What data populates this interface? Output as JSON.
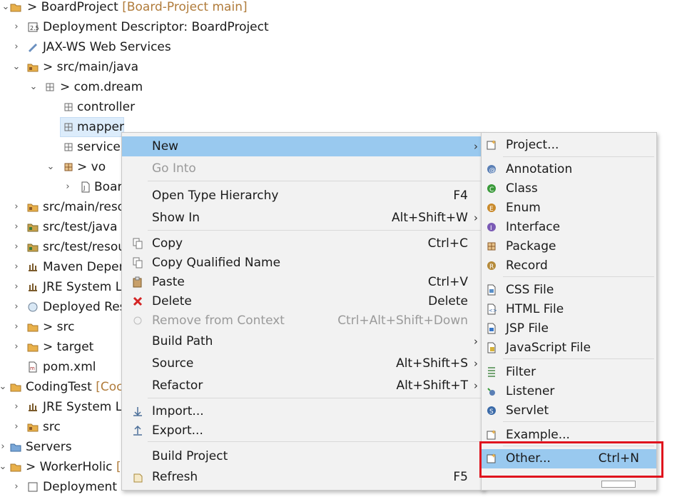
{
  "tree": {
    "rows": [
      {
        "label": "BoardProject",
        "decoration": "[Board-Project main]",
        "prefix": ">"
      },
      {
        "label": "Deployment Descriptor: BoardProject"
      },
      {
        "label": "JAX-WS Web Services"
      },
      {
        "label": "src/main/java",
        "prefix": ">"
      },
      {
        "label": "com.dream",
        "prefix": ">"
      },
      {
        "label": "controller"
      },
      {
        "label": "mapper"
      },
      {
        "label": "service"
      },
      {
        "label": "vo",
        "prefix": ">"
      },
      {
        "label": "Boar"
      },
      {
        "label": "src/main/reso"
      },
      {
        "label": "src/test/java"
      },
      {
        "label": "src/test/resou"
      },
      {
        "label": "Maven Deper"
      },
      {
        "label": "JRE System Li"
      },
      {
        "label": "Deployed Res"
      },
      {
        "label": "src",
        "prefix": ">"
      },
      {
        "label": "target",
        "prefix": ">"
      },
      {
        "label": "pom.xml"
      },
      {
        "label": "CodingTest",
        "decoration": "[Coc"
      },
      {
        "label": "JRE System Li"
      },
      {
        "label": "src"
      },
      {
        "label": "Servers"
      },
      {
        "label": "WorkerHolic",
        "decoration": "[V",
        "prefix": ">"
      },
      {
        "label": "Deployment"
      }
    ]
  },
  "menu": {
    "items": [
      {
        "label": "New",
        "arrow": "›"
      },
      {
        "label": "Go Into"
      },
      {
        "label": "Open Type Hierarchy",
        "shortcut": "F4"
      },
      {
        "label": "Show In",
        "shortcut": "Alt+Shift+W",
        "arrow": "›"
      },
      {
        "label": "Copy",
        "shortcut": "Ctrl+C"
      },
      {
        "label": "Copy Qualified Name"
      },
      {
        "label": "Paste",
        "shortcut": "Ctrl+V"
      },
      {
        "label": "Delete",
        "shortcut": "Delete"
      },
      {
        "label": "Remove from Context",
        "shortcut": "Ctrl+Alt+Shift+Down"
      },
      {
        "label": "Build Path",
        "arrow": "›"
      },
      {
        "label": "Source",
        "shortcut": "Alt+Shift+S",
        "arrow": "›"
      },
      {
        "label": "Refactor",
        "shortcut": "Alt+Shift+T",
        "arrow": "›"
      },
      {
        "label": "Import..."
      },
      {
        "label": "Export..."
      },
      {
        "label": "Build Project"
      },
      {
        "label": "Refresh",
        "shortcut": "F5"
      }
    ]
  },
  "submenu": {
    "items": [
      {
        "label": "Project..."
      },
      {
        "label": "Annotation"
      },
      {
        "label": "Class"
      },
      {
        "label": "Enum"
      },
      {
        "label": "Interface"
      },
      {
        "label": "Package"
      },
      {
        "label": "Record"
      },
      {
        "label": "CSS File"
      },
      {
        "label": "HTML File"
      },
      {
        "label": "JSP File"
      },
      {
        "label": "JavaScript File"
      },
      {
        "label": "Filter"
      },
      {
        "label": "Listener"
      },
      {
        "label": "Servlet"
      },
      {
        "label": "Example..."
      },
      {
        "label": "Other...",
        "shortcut": "Ctrl+N"
      }
    ]
  },
  "colors": {
    "highlight": "#99c9ef",
    "annotation": "#e0141e",
    "decoration": "#b07b3a"
  }
}
